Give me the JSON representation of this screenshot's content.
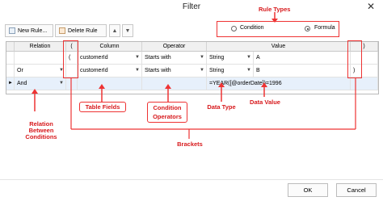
{
  "dialog": {
    "title": "Filter",
    "close_glyph": "✕"
  },
  "toolbar": {
    "new_rule_label": "New Rule...",
    "delete_rule_label": "Delete Rule",
    "move_up_glyph": "▲",
    "move_down_glyph": "▼"
  },
  "rule_types": {
    "label": "Rule Types",
    "condition_label": "Condition",
    "formula_label": "Formula",
    "selected": "Formula"
  },
  "grid": {
    "columns": [
      "",
      "Relation",
      "(",
      "Column",
      "Operator",
      "Value",
      ")"
    ],
    "rows": [
      {
        "relation": "",
        "open_bracket": "(",
        "column": "customerId",
        "operator": "Starts with",
        "value_type": "String",
        "value": "A",
        "close_bracket": ""
      },
      {
        "relation": "Or",
        "open_bracket": "",
        "column": "customerId",
        "operator": "Starts with",
        "value_type": "String",
        "value": "B",
        "close_bracket": ")"
      },
      {
        "relation": "And",
        "open_bracket": "",
        "column": "",
        "operator": "",
        "value_type": "",
        "value": "=YEAR([@orderDate])=1996",
        "close_bracket": ""
      }
    ]
  },
  "annotations": {
    "relation": "Relation Between Conditions",
    "table_fields": "Table Fields",
    "condition_operators": "Condition Operators",
    "data_type": "Data Type",
    "data_value": "Data Value",
    "brackets": "Brackets"
  },
  "footer": {
    "ok_label": "OK",
    "cancel_label": "Cancel"
  },
  "colors": {
    "annotation_red": "#d7191c",
    "selected_row": "#e7f0fb"
  }
}
